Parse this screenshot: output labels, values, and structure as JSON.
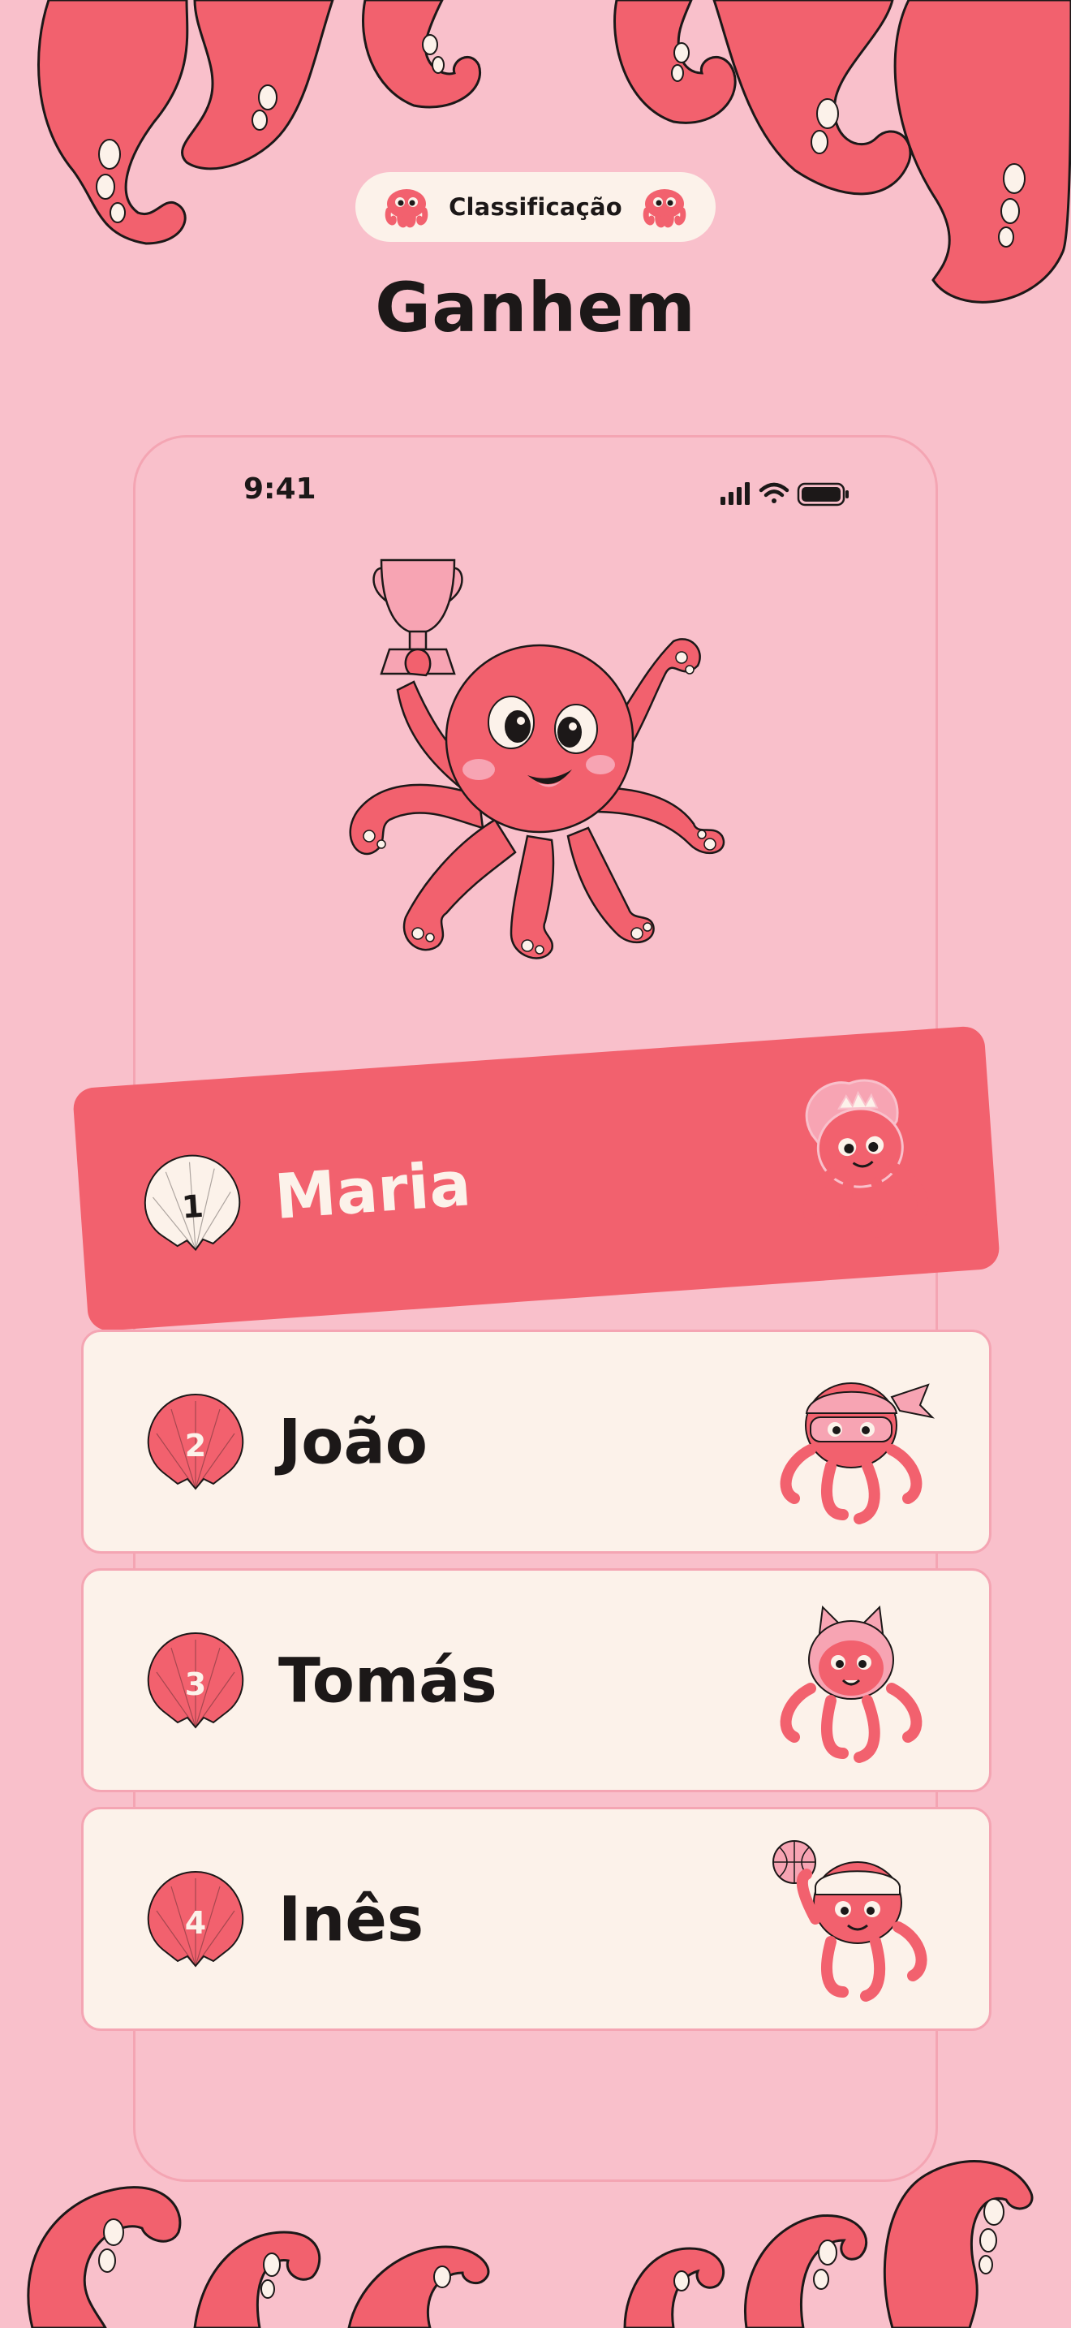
{
  "header": {
    "badge_label": "Classificação",
    "badge_icon": "octopus-icon",
    "title": "Ganhem"
  },
  "status_bar": {
    "time": "9:41",
    "icons": [
      "signal-icon",
      "wifi-icon",
      "battery-icon"
    ]
  },
  "hero": {
    "icon": "octopus-trophy-illustration"
  },
  "leaderboard": [
    {
      "rank": "1",
      "name": "Maria",
      "avatar": "octopus-princess-avatar"
    },
    {
      "rank": "2",
      "name": "João",
      "avatar": "octopus-ninja-avatar"
    },
    {
      "rank": "3",
      "name": "Tomás",
      "avatar": "octopus-cat-avatar"
    },
    {
      "rank": "4",
      "name": "Inês",
      "avatar": "octopus-basketball-avatar"
    }
  ],
  "colors": {
    "background": "#F9C0CB",
    "accent": "#F2616E",
    "cream": "#FCF2EA",
    "text": "#1C1818",
    "border": "#F4A5B3"
  }
}
